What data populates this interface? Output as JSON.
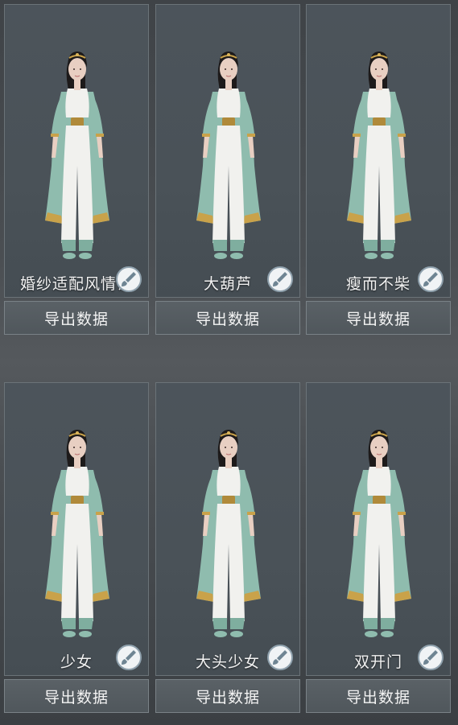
{
  "presets": [
    {
      "name": "婚纱适配风情设",
      "export_label": "导出数据",
      "edit_icon": "brush-icon"
    },
    {
      "name": "大葫芦",
      "export_label": "导出数据",
      "edit_icon": "brush-icon"
    },
    {
      "name": "瘦而不柴",
      "export_label": "导出数据",
      "edit_icon": "brush-icon"
    },
    {
      "name": "少女",
      "export_label": "导出数据",
      "edit_icon": "brush-icon"
    },
    {
      "name": "大头少女",
      "export_label": "导出数据",
      "edit_icon": "brush-icon"
    },
    {
      "name": "双开门",
      "export_label": "导出数据",
      "edit_icon": "brush-icon"
    }
  ],
  "colors": {
    "robe": "#8fbcae",
    "trim": "#c9a24a",
    "dress": "#f1f1ee",
    "hair": "#1d1a1a",
    "skin": "#e8cfc2"
  }
}
